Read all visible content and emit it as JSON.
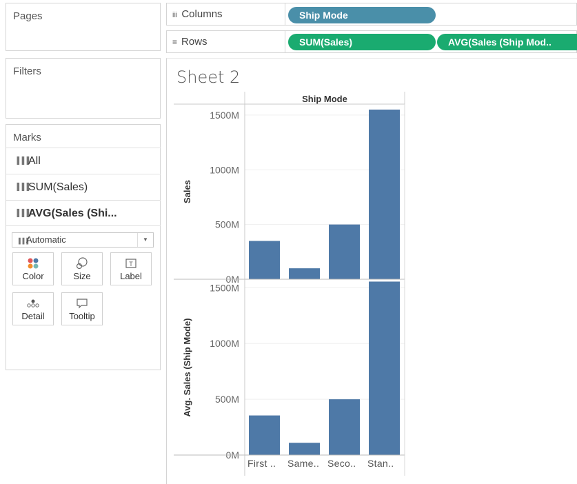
{
  "left_panel": {
    "pages_title": "Pages",
    "filters_title": "Filters",
    "marks_title": "Marks",
    "marks_items": [
      {
        "label": "All",
        "bold": false
      },
      {
        "label": "SUM(Sales)",
        "bold": false
      },
      {
        "label": "AVG(Sales (Shi...",
        "bold": true
      }
    ],
    "mark_type": "Automatic",
    "cards": [
      {
        "label": "Color",
        "icon": "color-dots-icon"
      },
      {
        "label": "Size",
        "icon": "size-icon"
      },
      {
        "label": "Label",
        "icon": "label-icon"
      },
      {
        "label": "Detail",
        "icon": "detail-icon"
      },
      {
        "label": "Tooltip",
        "icon": "tooltip-icon"
      }
    ]
  },
  "shelves": {
    "columns_label": "Columns",
    "rows_label": "Rows",
    "columns_pills": [
      "Ship Mode"
    ],
    "rows_pills": [
      "SUM(Sales)",
      "AVG(Sales (Ship Mod.."
    ]
  },
  "sheet": {
    "title": "Sheet 2"
  },
  "colors": {
    "bar": "#4e79a7",
    "pill_dimension": "#4a8fa9",
    "pill_measure": "#1aab70"
  },
  "chart_data": {
    "type": "bar",
    "title": "",
    "header": "Ship Mode",
    "categories": [
      "First ..",
      "Same..",
      "Seco..",
      "Stan.."
    ],
    "panes": [
      {
        "ylabel": "Sales",
        "values": [
          350,
          100,
          500,
          1550
        ],
        "ylim": [
          0,
          1600
        ],
        "ticks": [
          "0M",
          "500M",
          "1000M",
          "1500M"
        ],
        "tick_values": [
          0,
          500,
          1000,
          1500
        ]
      },
      {
        "ylabel": "Avg. Sales (Ship Mode)",
        "values": [
          355,
          110,
          500,
          1555
        ],
        "ylim": [
          0,
          1570
        ],
        "ticks": [
          "0M",
          "500M",
          "1000M",
          "1500M"
        ],
        "tick_values": [
          0,
          500,
          1000,
          1500
        ]
      }
    ]
  }
}
